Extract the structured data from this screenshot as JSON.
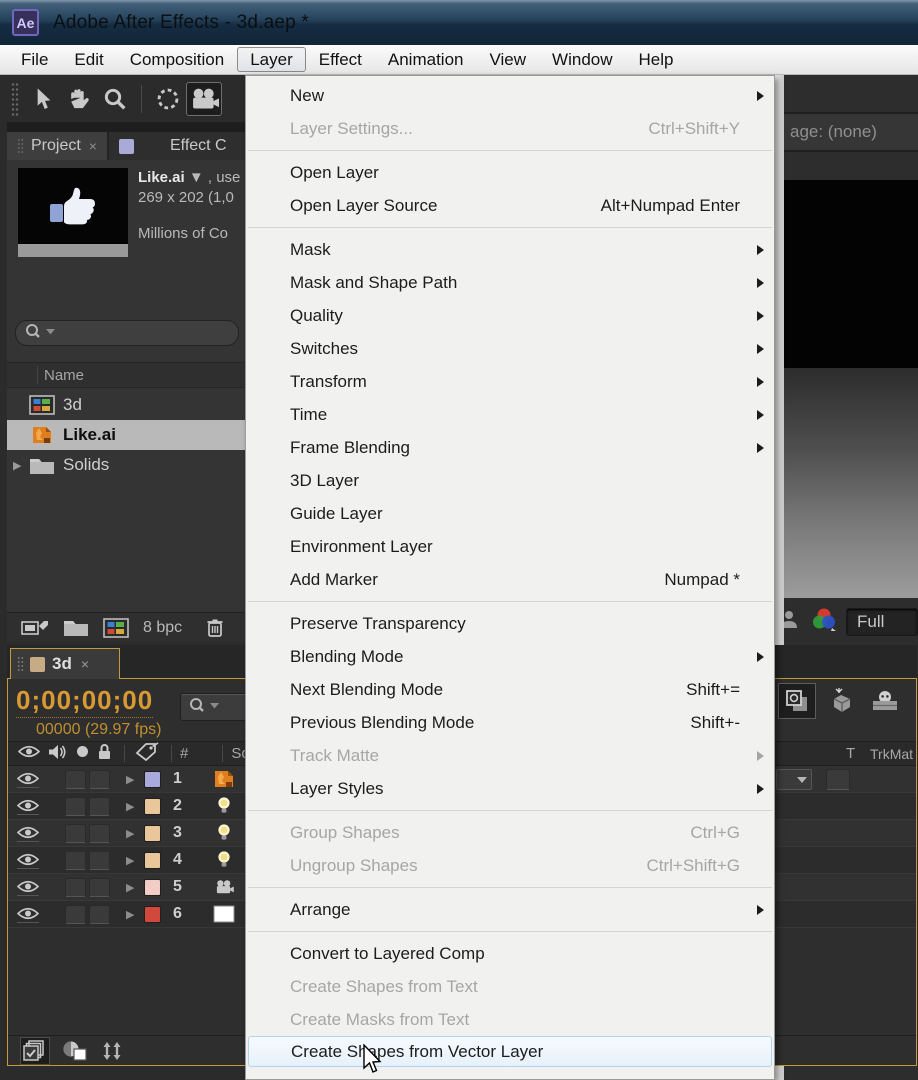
{
  "window": {
    "title": "Adobe After Effects - 3d.aep *",
    "icon_text": "Ae"
  },
  "menubar": {
    "items": [
      {
        "label": "File"
      },
      {
        "label": "Edit"
      },
      {
        "label": "Composition"
      },
      {
        "label": "Layer",
        "active": true
      },
      {
        "label": "Effect"
      },
      {
        "label": "Animation"
      },
      {
        "label": "View"
      },
      {
        "label": "Window"
      },
      {
        "label": "Help"
      }
    ]
  },
  "layer_menu": {
    "items": [
      {
        "label": "New",
        "submenu": true
      },
      {
        "label": "Layer Settings...",
        "shortcut": "Ctrl+Shift+Y",
        "disabled": true
      },
      {
        "separator": true
      },
      {
        "label": "Open Layer"
      },
      {
        "label": "Open Layer Source",
        "shortcut": "Alt+Numpad Enter"
      },
      {
        "separator": true
      },
      {
        "label": "Mask",
        "submenu": true
      },
      {
        "label": "Mask and Shape Path",
        "submenu": true
      },
      {
        "label": "Quality",
        "submenu": true
      },
      {
        "label": "Switches",
        "submenu": true
      },
      {
        "label": "Transform",
        "submenu": true
      },
      {
        "label": "Time",
        "submenu": true
      },
      {
        "label": "Frame Blending",
        "submenu": true
      },
      {
        "label": "3D Layer"
      },
      {
        "label": "Guide Layer"
      },
      {
        "label": "Environment Layer"
      },
      {
        "label": "Add Marker",
        "shortcut": "Numpad *"
      },
      {
        "separator": true
      },
      {
        "label": "Preserve Transparency"
      },
      {
        "label": "Blending Mode",
        "submenu": true
      },
      {
        "label": "Next Blending Mode",
        "shortcut": "Shift+="
      },
      {
        "label": "Previous Blending Mode",
        "shortcut": "Shift+-"
      },
      {
        "label": "Track Matte",
        "submenu": true,
        "disabled": true
      },
      {
        "label": "Layer Styles",
        "submenu": true
      },
      {
        "separator": true
      },
      {
        "label": "Group Shapes",
        "shortcut": "Ctrl+G",
        "disabled": true
      },
      {
        "label": "Ungroup Shapes",
        "shortcut": "Ctrl+Shift+G",
        "disabled": true
      },
      {
        "separator": true
      },
      {
        "label": "Arrange",
        "submenu": true
      },
      {
        "separator": true
      },
      {
        "label": "Convert to Layered Comp"
      },
      {
        "label": "Create Shapes from Text",
        "disabled": true
      },
      {
        "label": "Create Masks from Text",
        "disabled": true
      },
      {
        "label": "Create Shapes from Vector Layer",
        "highlighted": true
      }
    ]
  },
  "toolbar": {
    "tools": [
      {
        "name": "selection-tool",
        "icon": "selection"
      },
      {
        "name": "hand-tool",
        "icon": "hand"
      },
      {
        "name": "zoom-tool",
        "icon": "magnifier"
      },
      {
        "name": "rotate-tool",
        "icon": "rotate",
        "group_start": true
      },
      {
        "name": "camera-tool",
        "icon": "camera",
        "active": true
      }
    ]
  },
  "project_panel": {
    "tabs": {
      "first": "Project",
      "first_close": "×",
      "second": "Effect C",
      "second_swatch": "#a9aad8"
    },
    "preview": {
      "name": "Like.ai",
      "name_suffix": " ▼ , use",
      "line2": "269 x 202 (1,0",
      "line3": "Millions of Co"
    },
    "name_column": "Name",
    "items": [
      {
        "label": "3d",
        "icon": "composition"
      },
      {
        "label": "Like.ai",
        "icon": "ai-file",
        "selected": true
      },
      {
        "label": "Solids",
        "icon": "folder",
        "expander": "▶"
      }
    ],
    "footer": {
      "bit_depth": "8 bpc"
    }
  },
  "viewer": {
    "tab_label": "age: (none)",
    "resolution": "Full"
  },
  "timeline": {
    "tab": {
      "label": "3d",
      "swatch": "#c7ab85",
      "close": "×"
    },
    "time_display": "0;00;00;00",
    "frame_info": "00000 (29.97 fps)",
    "header": {
      "number": "#",
      "source": "So",
      "t": "T",
      "trkmat": "TrkMat"
    },
    "layers": [
      {
        "num": "1",
        "label_color": "#a8aade",
        "icon": "ai-file",
        "has_mode": true
      },
      {
        "num": "2",
        "label_color": "#e9c79a",
        "icon": "light-bulb"
      },
      {
        "num": "3",
        "label_color": "#e9c79a",
        "icon": "light-bulb"
      },
      {
        "num": "4",
        "label_color": "#e9c79a",
        "icon": "light-bulb"
      },
      {
        "num": "5",
        "label_color": "#f2cdc8",
        "icon": "camera-small"
      },
      {
        "num": "6",
        "label_color": "#d0493c",
        "icon": "white-solid"
      }
    ],
    "switches": [
      {
        "name": "live-update",
        "active": true
      },
      {
        "name": "draft-3d"
      },
      {
        "name": "shy-layers"
      },
      {
        "name": "frame-blending"
      }
    ],
    "footer_icons": [
      "blend-visibility",
      "transfer-controls",
      "expand-columns"
    ]
  },
  "colors": {
    "panel_accent_orange": "#c49a3c",
    "timecode_orange": "#d89a33",
    "selection_grey": "#b9b9b9",
    "menu_highlight_border": "#b4d3ec"
  }
}
